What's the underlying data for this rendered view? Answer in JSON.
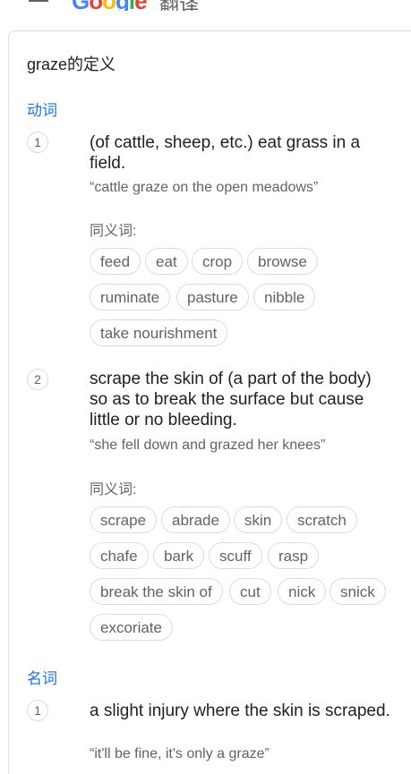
{
  "header": {
    "logo_text": "Google",
    "logo_suffix": "翻译",
    "icons": [
      "menu-icon"
    ]
  },
  "definitions": {
    "heading": "graze的定义",
    "verb_label": "动词",
    "noun_label": "名词",
    "synonyms_label": "同义词:",
    "verb_senses": [
      {
        "number": "1",
        "gloss": "(of cattle, sheep, etc.) eat grass in a field.",
        "example": "“cattle graze on the open meadows”",
        "synonyms": [
          "feed",
          "eat",
          "crop",
          "browse",
          "ruminate",
          "pasture",
          "nibble",
          "take nourishment"
        ]
      },
      {
        "number": "2",
        "gloss": "scrape the skin of (a part of the body) so as to break the surface but cause little or no bleeding.",
        "example": "“she fell down and grazed her knees”",
        "synonyms": [
          "scrape",
          "abrade",
          "skin",
          "scratch",
          "chafe",
          "bark",
          "scuff",
          "rasp",
          "break the skin of",
          "cut",
          "nick",
          "snick",
          "excoriate"
        ]
      }
    ],
    "noun_senses": [
      {
        "number": "1",
        "gloss": "a slight injury where the skin is scraped.",
        "example": "“it'll be fine, it's only a graze”"
      }
    ]
  }
}
